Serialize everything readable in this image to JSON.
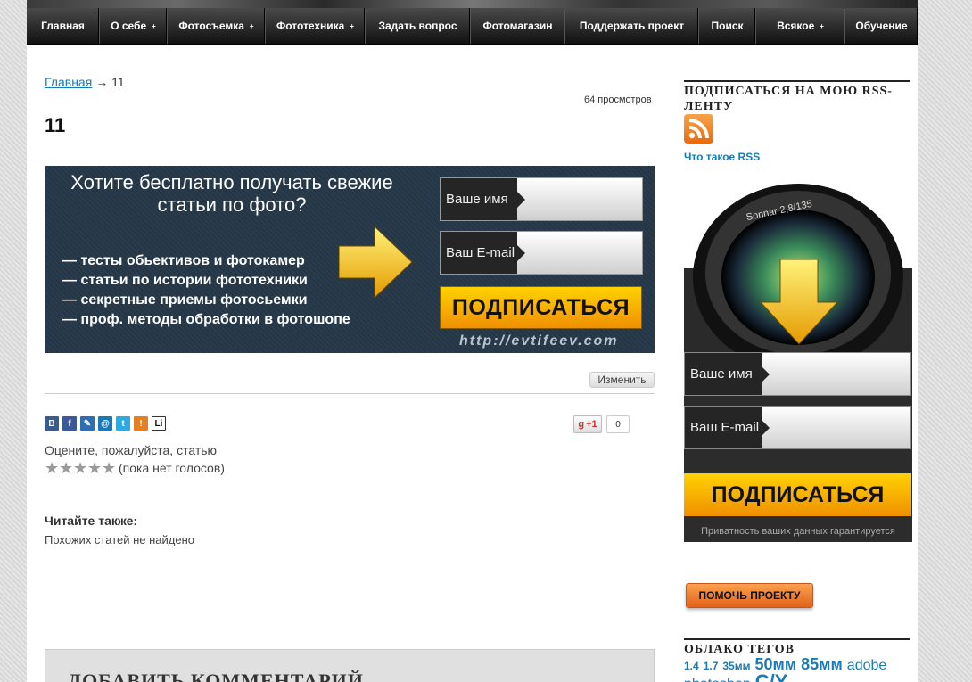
{
  "nav": [
    "Главная",
    "О себе",
    "Фотосъемка",
    "Фототехника",
    "Задать вопрос",
    "Фотомагазин",
    "Поддержать проект",
    "Поиск",
    "Всякое",
    "Обучение"
  ],
  "nav_dropdown_arrow": "+",
  "breadcrumb": {
    "home": "Главная",
    "sep": "→",
    "current": "11"
  },
  "views": "64 просмотров",
  "title": "11",
  "banner": {
    "headline": "Хотите бесплатно получать свежие статьи по фото?",
    "bullets": [
      "— тесты обьективов и фотокамер",
      "— статьи по истории фототехники",
      "— секретные приемы фотосьемки",
      "— проф. методы обработки в фотошопе"
    ],
    "name_label": "Ваше имя",
    "email_label": "Ваш E-mail",
    "button": "ПОДПИСАТЬСЯ",
    "url": "http://evtifeev.com"
  },
  "edit": "Изменить",
  "share_icons": [
    "vkontakte-icon",
    "facebook-icon",
    "livejournal-icon",
    "mailru-icon",
    "twitter-icon",
    "odnoklassniki-icon",
    "liveinternet-icon"
  ],
  "share_letters": [
    "В",
    "f",
    "✎",
    "@",
    "t",
    "!",
    "Li"
  ],
  "gplus": {
    "label": "+1",
    "count": "0"
  },
  "rating": {
    "prompt": "Оцените, пожалуйста, статью",
    "stars": 5,
    "votes": "(пока нет голосов)"
  },
  "also": {
    "title": "Читайте также:",
    "text": "Похожих статей не найдено"
  },
  "comment_title": "ДОБАВИТЬ КОММЕНТАРИЙ",
  "sidebar": {
    "rss_title": "ПОДПИСАТЬСЯ НА МОЮ RSS-ЛЕНТУ",
    "rss_link": "Что такое RSS",
    "lens_text": "Sonnar 2,8/135",
    "name_label": "Ваше имя",
    "email_label": "Ваш E-mail",
    "button": "ПОДПИСАТЬСЯ",
    "privacy": "Приватность ваших данных гарантируется",
    "help_button": "ПОМОЧЬ ПРОЕКТУ",
    "cloud_title": "ОБЛАКО ТЕГОВ",
    "tags": [
      "1.4",
      "1.7",
      "35мм",
      "50мм",
      "85мм",
      "adobe",
      "photoshop",
      "",
      "",
      "",
      "C/Y"
    ]
  },
  "colors": {
    "accent": "#1a7ab8",
    "button": "#f5a800",
    "nav": "#1e1e1e"
  }
}
